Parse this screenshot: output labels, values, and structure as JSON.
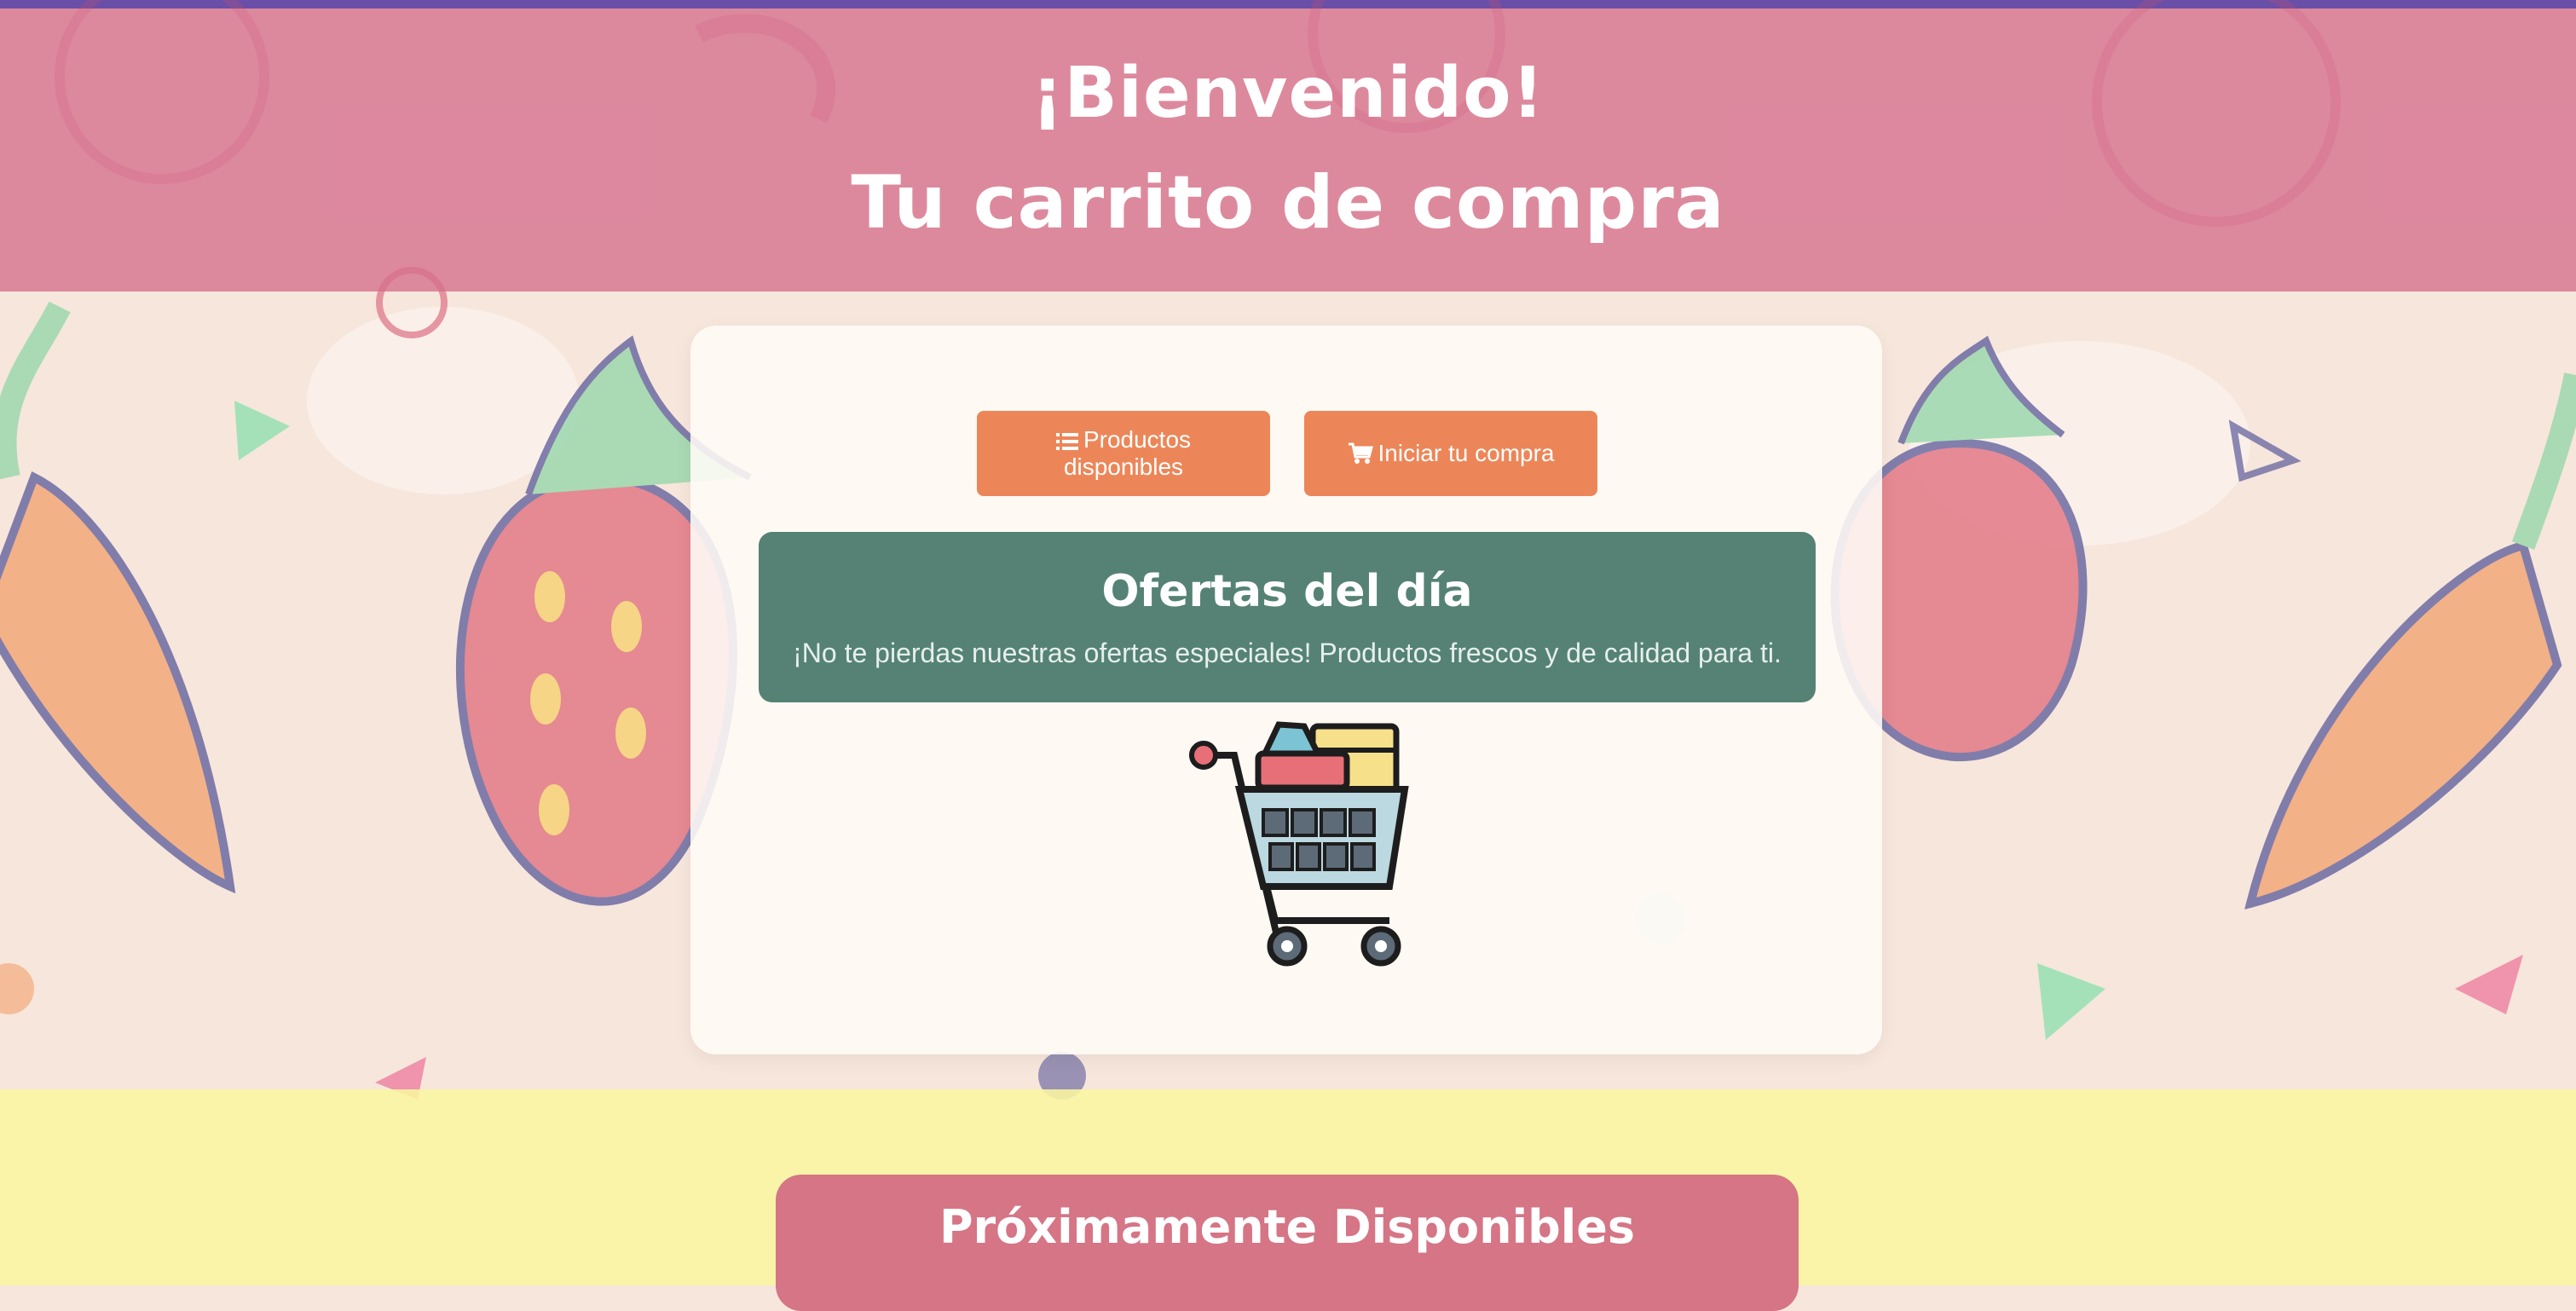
{
  "header": {
    "title_line1": "¡Bienvenido!",
    "title_line2": "Tu carrito de compra"
  },
  "buttons": {
    "products_label_line1": "Productos",
    "products_label_line2": "disponibles",
    "products_icon": "list-icon",
    "start_label": "Iniciar tu compra",
    "start_icon": "shopping-cart-icon"
  },
  "offers": {
    "title": "Ofertas del día",
    "text": "¡No te pierdas nuestras ofertas especiales! Productos frescos y de calidad para ti."
  },
  "illustration": "shopping-cart-illustration",
  "coming_soon": {
    "title": "Próximamente Disponibles"
  },
  "colors": {
    "top_bar": "#6a4fa8",
    "header": "#d66e8c",
    "button": "#ec8658",
    "offers": "#558275",
    "coming_soon": "#d57585",
    "lower_band": "#faf6a0"
  }
}
